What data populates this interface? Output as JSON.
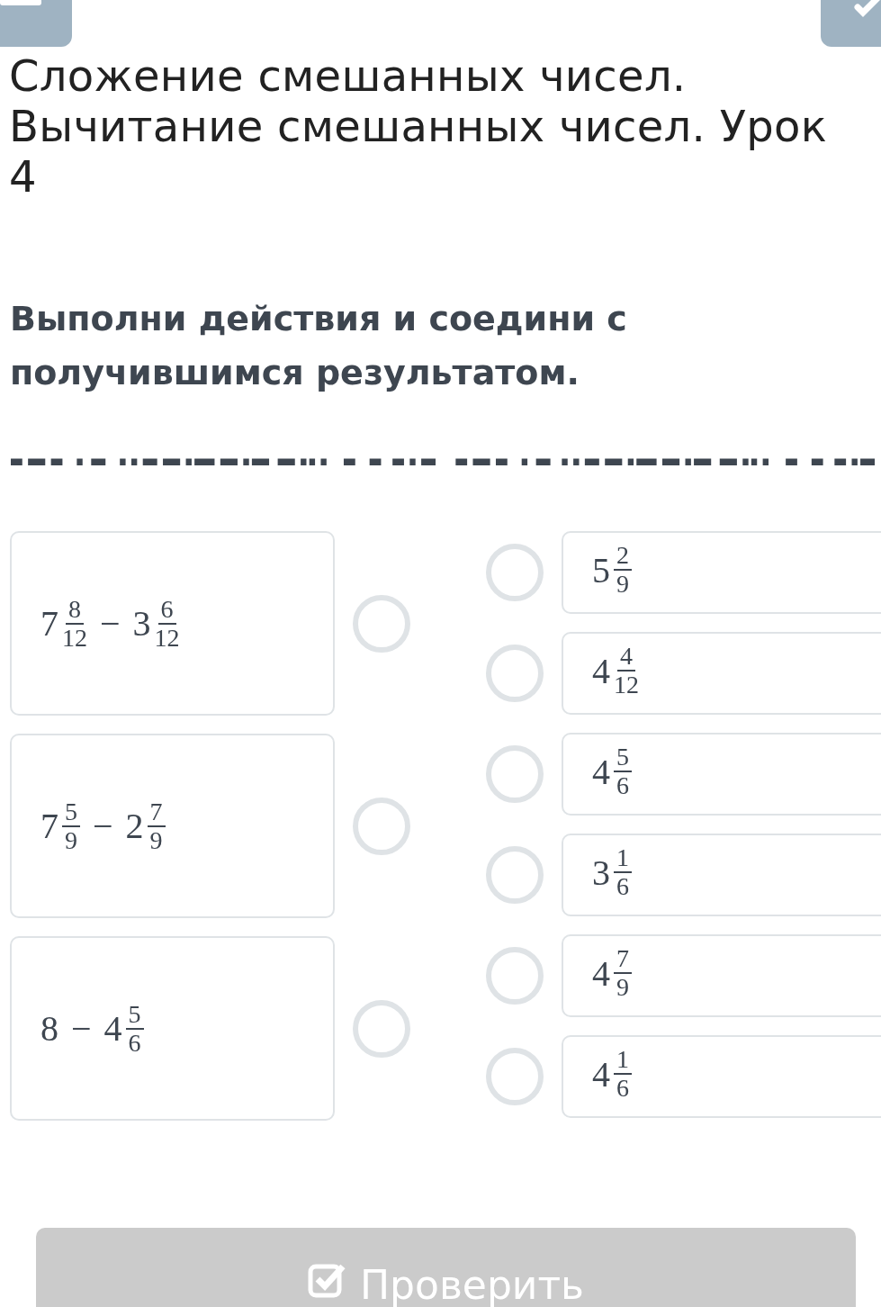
{
  "title": "Сложение смешанных чисел. Вычитание смешанных чисел. Урок 4",
  "question": "Выполни действия и соедини с получившимся результатом.",
  "expressions": [
    {
      "selected": false,
      "parts": [
        {
          "kind": "mixed",
          "whole": "7",
          "num": "8",
          "den": "12"
        },
        {
          "kind": "op",
          "text": "−"
        },
        {
          "kind": "mixed",
          "whole": "3",
          "num": "6",
          "den": "12"
        }
      ]
    },
    {
      "selected": false,
      "parts": [
        {
          "kind": "mixed",
          "whole": "7",
          "num": "5",
          "den": "9"
        },
        {
          "kind": "op",
          "text": "−"
        },
        {
          "kind": "mixed",
          "whole": "2",
          "num": "7",
          "den": "9"
        }
      ]
    },
    {
      "selected": false,
      "parts": [
        {
          "kind": "int",
          "text": "8"
        },
        {
          "kind": "op",
          "text": "−"
        },
        {
          "kind": "mixed",
          "whole": "4",
          "num": "5",
          "den": "6"
        }
      ]
    }
  ],
  "answers": [
    {
      "selected": false,
      "whole": "5",
      "num": "2",
      "den": "9"
    },
    {
      "selected": false,
      "whole": "4",
      "num": "4",
      "den": "12"
    },
    {
      "selected": false,
      "whole": "4",
      "num": "5",
      "den": "6"
    },
    {
      "selected": false,
      "whole": "3",
      "num": "1",
      "den": "6"
    },
    {
      "selected": false,
      "whole": "4",
      "num": "7",
      "den": "9"
    },
    {
      "selected": false,
      "whole": "4",
      "num": "1",
      "den": "6"
    }
  ],
  "check_button": {
    "label": "Проверить",
    "disabled": true
  }
}
